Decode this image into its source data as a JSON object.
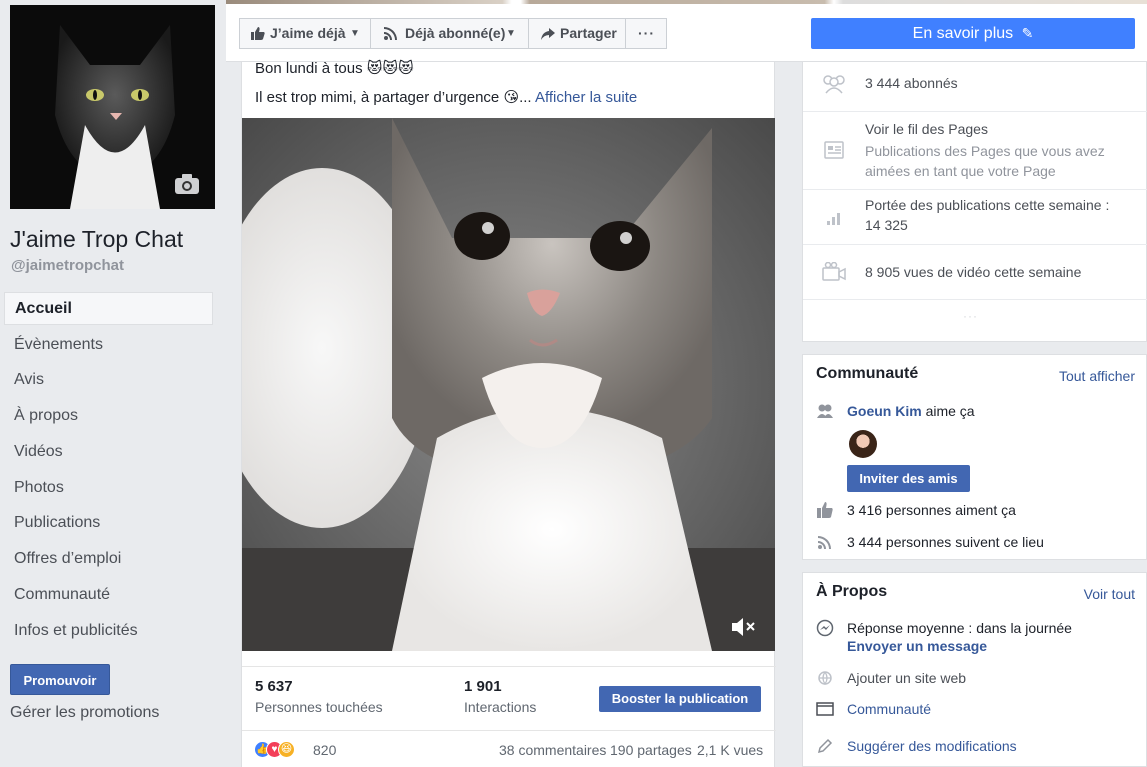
{
  "page": {
    "name": "J'aime Trop Chat",
    "handle": "@jaimetropchat"
  },
  "nav": [
    {
      "label": "Accueil",
      "active": true
    },
    {
      "label": "Évènements"
    },
    {
      "label": "Avis"
    },
    {
      "label": "À propos"
    },
    {
      "label": "Vidéos"
    },
    {
      "label": "Photos"
    },
    {
      "label": "Publications"
    },
    {
      "label": "Offres d’emploi"
    },
    {
      "label": "Communauté"
    },
    {
      "label": "Infos et publicités"
    }
  ],
  "promote": {
    "button": "Promouvoir",
    "manage": "Gérer les promotions"
  },
  "actions": {
    "like": "J’aime déjà",
    "follow": "Déjà abonné(e)",
    "share": "Partager",
    "more": "···",
    "learn_more": "En savoir plus"
  },
  "post": {
    "line1": "Bon lundi à tous 😻😻😻",
    "line2": "Il est trop mimi, à partager d’urgence 😘...",
    "see_more": "Afficher la suite",
    "reach_value": "5 637",
    "reach_label": "Personnes touchées",
    "engagement_value": "1 901",
    "engagement_label": "Interactions",
    "boost": "Booster la publication",
    "reactions_count": "820",
    "comments": "38 commentaires",
    "shares": "190 partages",
    "views": "2,1 K vues"
  },
  "right": {
    "followers": "3 444 abonnés",
    "feed_title": "Voir le fil des Pages",
    "feed_sub1": "Publications des Pages que vous avez",
    "feed_sub2": "aimées en tant que votre Page",
    "reach_line1": "Portée des publications cette semaine :",
    "reach_line2": "14 325",
    "video_views": "8 905 vues de vidéo cette semaine",
    "dots": "···"
  },
  "community": {
    "title": "Communauté",
    "see_all": "Tout afficher",
    "friend_name": "Goeun Kim",
    "friend_action": "aime ça",
    "invite": "Inviter des amis",
    "likes": "3 416 personnes aiment ça",
    "follows": "3 444 personnes suivent ce lieu"
  },
  "about": {
    "title": "À Propos",
    "see_all": "Voir tout",
    "response": "Réponse moyenne : dans la journée",
    "message": "Envoyer un message",
    "website": "Ajouter un site web",
    "category": "Communauté",
    "suggest": "Suggérer des modifications"
  },
  "colors": {
    "brand": "#4267b2",
    "accent": "#4080ff",
    "link": "#365899",
    "bg": "#e9ebee"
  }
}
